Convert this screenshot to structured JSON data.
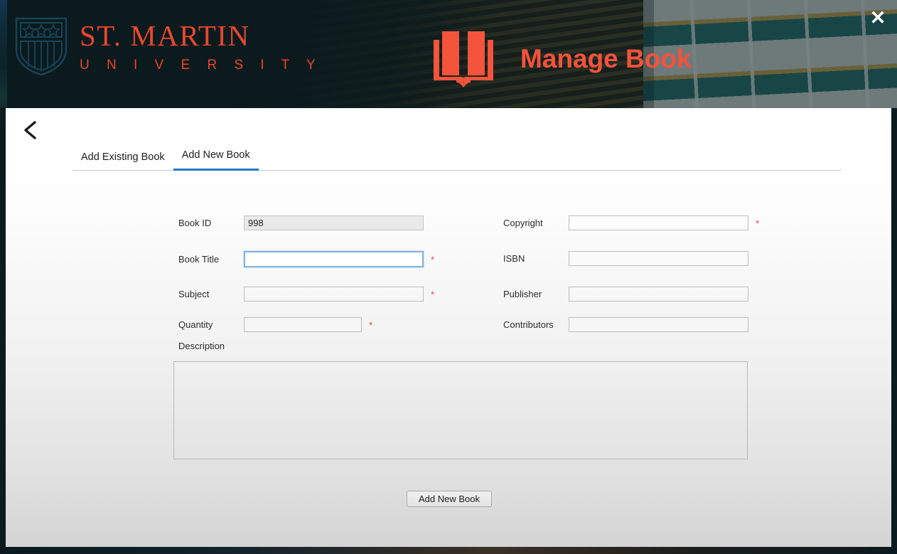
{
  "window": {
    "close_label": "✕",
    "back_label": "‹"
  },
  "brand": {
    "name": "ST. MARTIN",
    "subtitle": "U N I V E R S I T Y",
    "logo_icon": "shield-stars-icon",
    "accent_color": "#e8472f"
  },
  "header": {
    "title": "Manage Book",
    "title_icon": "open-book-icon",
    "title_color": "#f4533c"
  },
  "tabs": [
    {
      "label": "Add Existing Book",
      "active": false
    },
    {
      "label": "Add New Book",
      "active": true
    }
  ],
  "form": {
    "left_fields": [
      {
        "label": "Book ID",
        "value": "998",
        "placeholder": "",
        "required": false,
        "readonly": true,
        "focused": false
      },
      {
        "label": "Book Title",
        "value": "",
        "placeholder": "",
        "required": true,
        "readonly": false,
        "focused": true
      },
      {
        "label": "Subject",
        "value": "",
        "placeholder": "",
        "required": true,
        "readonly": false,
        "focused": false
      },
      {
        "label": "Quantity",
        "value": "",
        "placeholder": "",
        "required": true,
        "readonly": false,
        "focused": false
      }
    ],
    "right_fields": [
      {
        "label": "Copyright",
        "value": "",
        "placeholder": "",
        "required": true,
        "readonly": false,
        "focused": false
      },
      {
        "label": "ISBN",
        "value": "",
        "placeholder": "",
        "required": false,
        "readonly": false,
        "focused": false
      },
      {
        "label": "Publisher",
        "value": "",
        "placeholder": "",
        "required": false,
        "readonly": false,
        "focused": false
      },
      {
        "label": "Contributors",
        "value": "",
        "placeholder": "",
        "required": false,
        "readonly": false,
        "focused": false
      }
    ],
    "description": {
      "label": "Description",
      "value": "",
      "placeholder": ""
    },
    "required_marker": "*",
    "submit_label": "Add New Book"
  }
}
